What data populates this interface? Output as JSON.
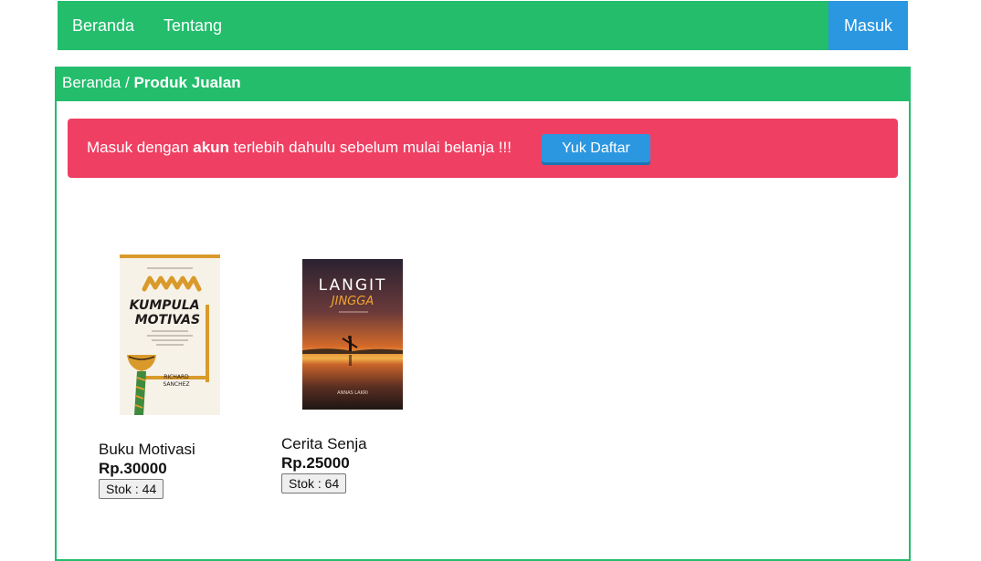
{
  "navbar": {
    "home_label": "Beranda",
    "about_label": "Tentang",
    "login_label": "Masuk"
  },
  "breadcrumb": {
    "home": "Beranda",
    "separator": " / ",
    "current": "Produk Jualan"
  },
  "alert": {
    "text_before": "Masuk dengan ",
    "text_bold": "akun",
    "text_after": " terlebih dahulu sebelum mulai belanja !!!",
    "button_label": "Yuk Daftar"
  },
  "products": [
    {
      "name": "Buku Motivasi",
      "price": "Rp.30000",
      "stock_label": "Stok : 44",
      "cover": {
        "title_line1": "KUMPULAN",
        "title_line2": "MOTIVASI",
        "author_line1": "RICHARD",
        "author_line2": "SANCHEZ"
      }
    },
    {
      "name": "Cerita Senja",
      "price": "Rp.25000",
      "stock_label": "Stok : 64",
      "cover": {
        "title_line1": "LANGIT",
        "title_line2": "JINGGA",
        "author": "ANNAS LAKRI"
      }
    }
  ],
  "colors": {
    "brand_green": "#23bd6c",
    "accent_blue": "#2b97e1",
    "alert_red": "#ef4063"
  }
}
